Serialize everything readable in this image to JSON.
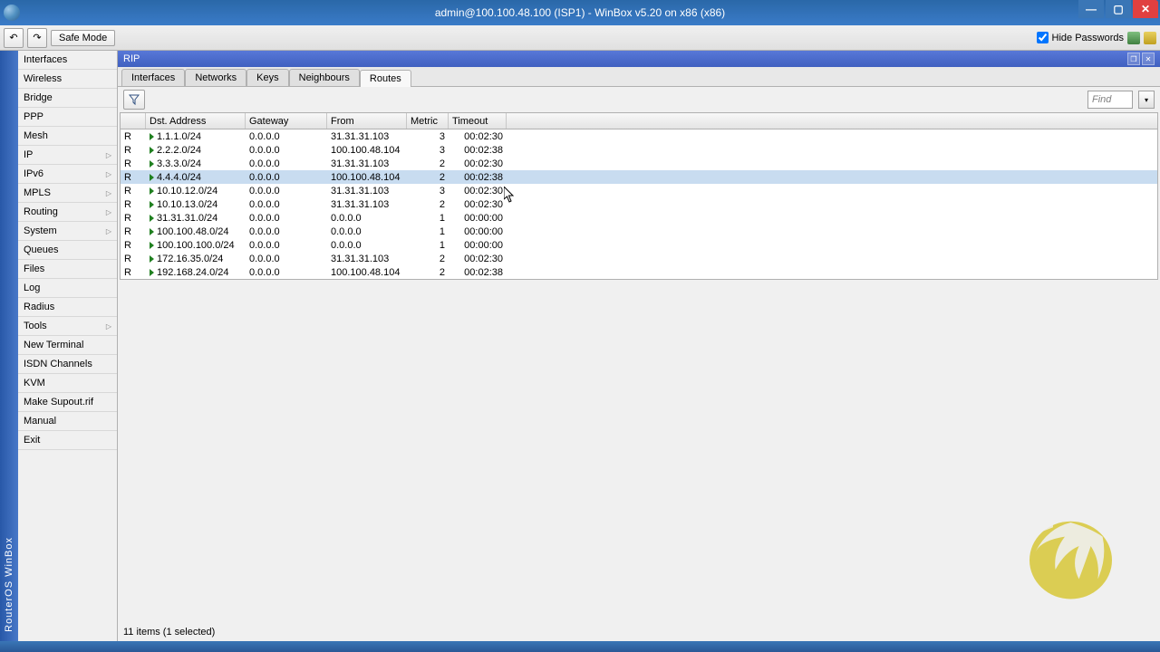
{
  "window": {
    "title": "admin@100.100.48.100 (ISP1) - WinBox v5.20 on x86 (x86)"
  },
  "toolbar": {
    "safe_mode": "Safe Mode",
    "hide_passwords": "Hide Passwords"
  },
  "sidebar_rail": "RouterOS WinBox",
  "sidebar": {
    "items": [
      {
        "label": "Interfaces",
        "sub": false
      },
      {
        "label": "Wireless",
        "sub": false
      },
      {
        "label": "Bridge",
        "sub": false
      },
      {
        "label": "PPP",
        "sub": false
      },
      {
        "label": "Mesh",
        "sub": false
      },
      {
        "label": "IP",
        "sub": true
      },
      {
        "label": "IPv6",
        "sub": true
      },
      {
        "label": "MPLS",
        "sub": true
      },
      {
        "label": "Routing",
        "sub": true
      },
      {
        "label": "System",
        "sub": true
      },
      {
        "label": "Queues",
        "sub": false
      },
      {
        "label": "Files",
        "sub": false
      },
      {
        "label": "Log",
        "sub": false
      },
      {
        "label": "Radius",
        "sub": false
      },
      {
        "label": "Tools",
        "sub": true
      },
      {
        "label": "New Terminal",
        "sub": false
      },
      {
        "label": "ISDN Channels",
        "sub": false
      },
      {
        "label": "KVM",
        "sub": false
      },
      {
        "label": "Make Supout.rif",
        "sub": false
      },
      {
        "label": "Manual",
        "sub": false
      },
      {
        "label": "Exit",
        "sub": false
      }
    ]
  },
  "panel": {
    "title": "RIP"
  },
  "tabs": [
    {
      "label": "Interfaces",
      "active": false
    },
    {
      "label": "Networks",
      "active": false
    },
    {
      "label": "Keys",
      "active": false
    },
    {
      "label": "Neighbours",
      "active": false
    },
    {
      "label": "Routes",
      "active": true
    }
  ],
  "find_placeholder": "Find",
  "columns": [
    "",
    "Dst. Address",
    "Gateway",
    "From",
    "Metric",
    "Timeout"
  ],
  "rows": [
    {
      "flag": "R",
      "dst": "1.1.1.0/24",
      "gw": "0.0.0.0",
      "from": "31.31.31.103",
      "metric": "3",
      "timeout": "00:02:30",
      "sel": false
    },
    {
      "flag": "R",
      "dst": "2.2.2.0/24",
      "gw": "0.0.0.0",
      "from": "100.100.48.104",
      "metric": "3",
      "timeout": "00:02:38",
      "sel": false
    },
    {
      "flag": "R",
      "dst": "3.3.3.0/24",
      "gw": "0.0.0.0",
      "from": "31.31.31.103",
      "metric": "2",
      "timeout": "00:02:30",
      "sel": false
    },
    {
      "flag": "R",
      "dst": "4.4.4.0/24",
      "gw": "0.0.0.0",
      "from": "100.100.48.104",
      "metric": "2",
      "timeout": "00:02:38",
      "sel": true
    },
    {
      "flag": "R",
      "dst": "10.10.12.0/24",
      "gw": "0.0.0.0",
      "from": "31.31.31.103",
      "metric": "3",
      "timeout": "00:02:30",
      "sel": false
    },
    {
      "flag": "R",
      "dst": "10.10.13.0/24",
      "gw": "0.0.0.0",
      "from": "31.31.31.103",
      "metric": "2",
      "timeout": "00:02:30",
      "sel": false
    },
    {
      "flag": "R",
      "dst": "31.31.31.0/24",
      "gw": "0.0.0.0",
      "from": "0.0.0.0",
      "metric": "1",
      "timeout": "00:00:00",
      "sel": false
    },
    {
      "flag": "R",
      "dst": "100.100.48.0/24",
      "gw": "0.0.0.0",
      "from": "0.0.0.0",
      "metric": "1",
      "timeout": "00:00:00",
      "sel": false
    },
    {
      "flag": "R",
      "dst": "100.100.100.0/24",
      "gw": "0.0.0.0",
      "from": "0.0.0.0",
      "metric": "1",
      "timeout": "00:00:00",
      "sel": false
    },
    {
      "flag": "R",
      "dst": "172.16.35.0/24",
      "gw": "0.0.0.0",
      "from": "31.31.31.103",
      "metric": "2",
      "timeout": "00:02:30",
      "sel": false
    },
    {
      "flag": "R",
      "dst": "192.168.24.0/24",
      "gw": "0.0.0.0",
      "from": "100.100.48.104",
      "metric": "2",
      "timeout": "00:02:38",
      "sel": false
    }
  ],
  "status": "11 items (1 selected)"
}
